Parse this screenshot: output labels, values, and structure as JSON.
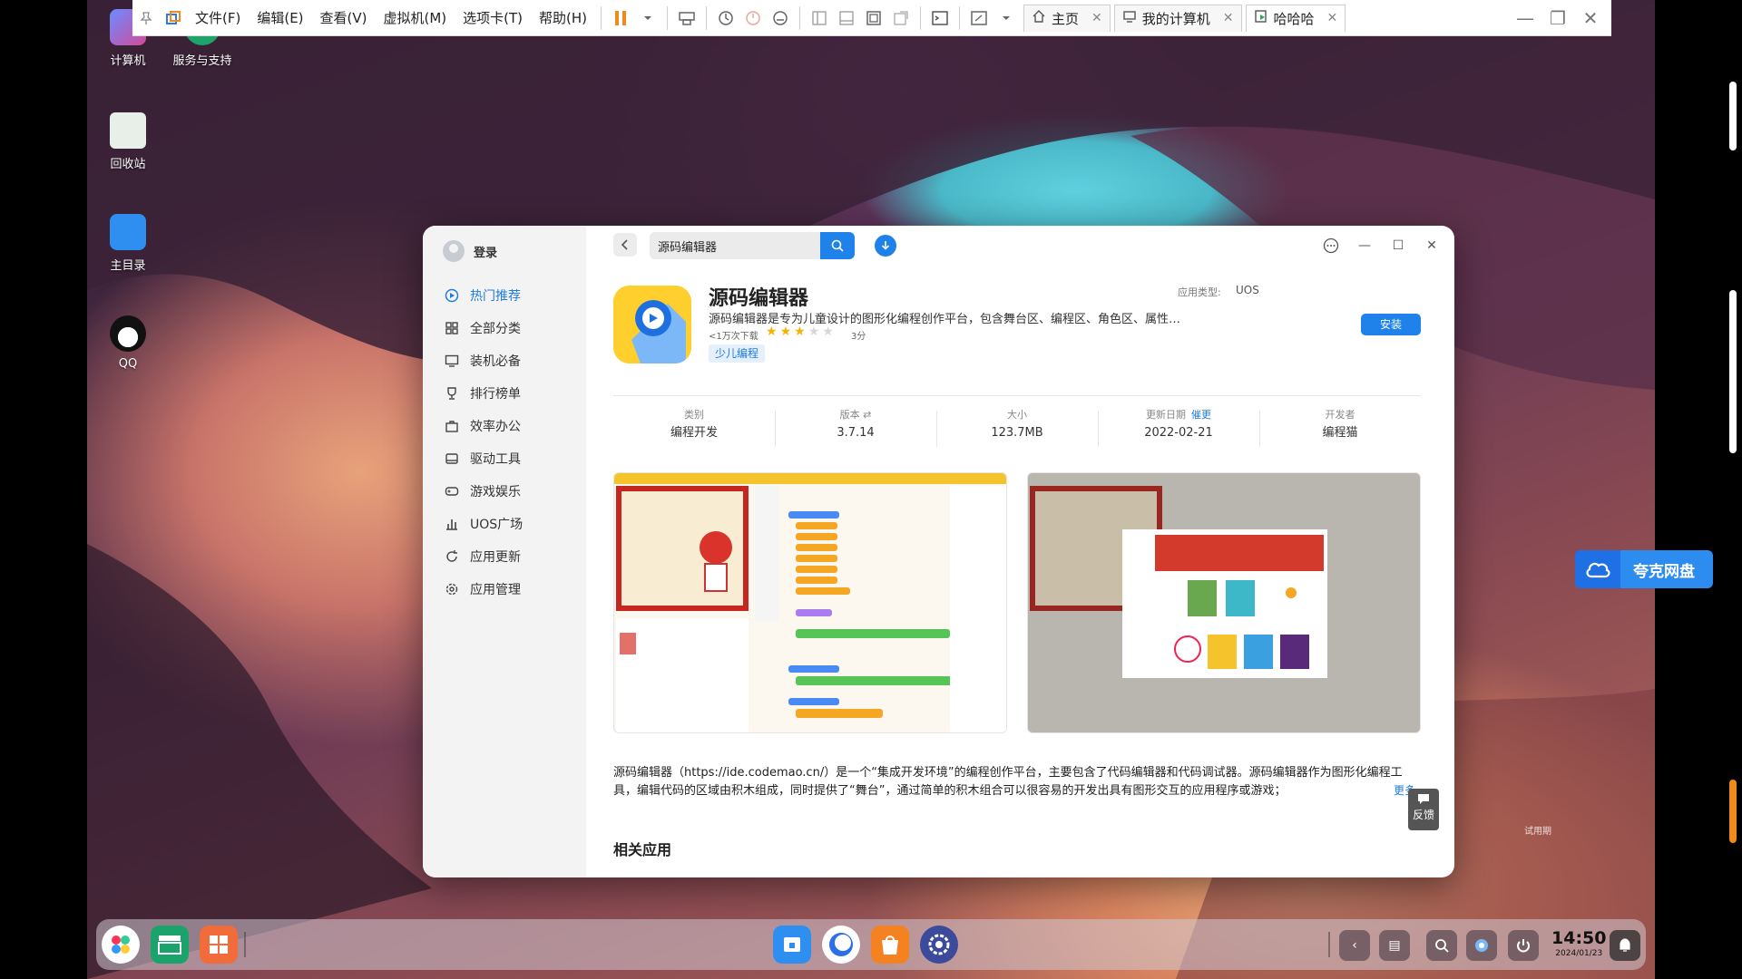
{
  "vm_toolbar": {
    "menus": [
      "文件(F)",
      "编辑(E)",
      "查看(V)",
      "虚拟机(M)",
      "选项卡(T)",
      "帮助(H)"
    ],
    "tabs": [
      {
        "label": "主页",
        "icon": "home-icon",
        "active": false
      },
      {
        "label": "我的计算机",
        "icon": "monitor-icon",
        "active": false
      },
      {
        "label": "哈哈哈",
        "icon": "vm-running-icon",
        "active": true
      }
    ]
  },
  "desktop": {
    "icons": [
      {
        "label": "计算机",
        "icon": "computer-icon"
      },
      {
        "label": "服务与支持",
        "icon": "support-icon"
      },
      {
        "label": "回收站",
        "icon": "trash-icon"
      },
      {
        "label": "主目录",
        "icon": "home-folder-icon"
      },
      {
        "label": "QQ",
        "icon": "qq-penguin-icon"
      }
    ],
    "quark_label": "夸克网盘",
    "feedback_label": "反馈",
    "trial_text": "试用期"
  },
  "store": {
    "login_label": "登录",
    "nav": [
      {
        "label": "热门推荐",
        "icon": "compass-icon",
        "active": true
      },
      {
        "label": "全部分类",
        "icon": "grid-icon",
        "active": false
      },
      {
        "label": "装机必备",
        "icon": "monitor-icon",
        "active": false
      },
      {
        "label": "排行榜单",
        "icon": "trophy-icon",
        "active": false
      },
      {
        "label": "效率办公",
        "icon": "briefcase-icon",
        "active": false
      },
      {
        "label": "驱动工具",
        "icon": "drive-icon",
        "active": false
      },
      {
        "label": "游戏娱乐",
        "icon": "gamepad-icon",
        "active": false
      },
      {
        "label": "UOS广场",
        "icon": "chart-icon",
        "active": false
      },
      {
        "label": "应用更新",
        "icon": "refresh-icon",
        "active": false
      },
      {
        "label": "应用管理",
        "icon": "gear-icon",
        "active": false
      }
    ],
    "search": {
      "value": "源码编辑器"
    },
    "app": {
      "name": "源码编辑器",
      "description": "源码编辑器是专为儿童设计的图形化编程创作平台，包含舞台区、编程区、角色区、属性…",
      "downloads": "<1万次下载",
      "rating": 3,
      "rating_max": 5,
      "score": "3分",
      "tag": "少儿编程",
      "type_label": "应用类型:",
      "type_value": "UOS",
      "install_label": "安装",
      "accent": "#1f82ea"
    },
    "info": [
      {
        "label": "类别",
        "value": "编程开发"
      },
      {
        "label": "版本 ⇄",
        "value": "3.7.14"
      },
      {
        "label": "大小",
        "value": "123.7MB"
      },
      {
        "label": "更新日期",
        "link": "催更",
        "value": "2022-02-21"
      },
      {
        "label": "开发者",
        "value": "编程猫"
      }
    ],
    "long_description": "源码编辑器（https://ide.codemao.cn/）是一个“集成开发环境”的编程创作平台，主要包含了代码编辑器和代码调试器。源码编辑器作为图形化编程工具，编辑代码的区域由积木组成，同时提供了“舞台”，通过简单的积木组合可以很容易的开发出具有图形交互的应用程序或游戏；",
    "more_label": "更多",
    "related_title": "相关应用"
  },
  "taskbar": {
    "time": "14:50",
    "date": "2024/01/23"
  }
}
